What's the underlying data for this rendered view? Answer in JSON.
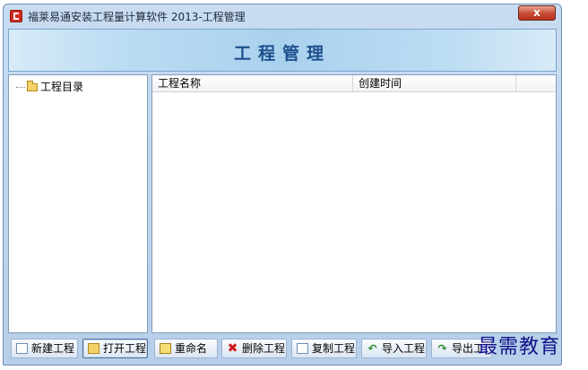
{
  "window": {
    "title": "福莱易通安装工程量计算软件 2013-工程管理",
    "close_label": "x"
  },
  "banner": {
    "title": "工程管理"
  },
  "tree": {
    "root_label": "工程目录",
    "root_icon": "folder-icon"
  },
  "list": {
    "columns": [
      "工程名称",
      "创建时间",
      ""
    ],
    "rows": []
  },
  "toolbar": {
    "buttons": [
      {
        "label": "新建工程",
        "icon": "new-file-icon"
      },
      {
        "label": "打开工程",
        "icon": "folder-open-icon"
      },
      {
        "label": "重命名",
        "icon": "rename-icon"
      },
      {
        "label": "删除工程",
        "icon": "delete-icon"
      },
      {
        "label": "复制工程",
        "icon": "copy-icon"
      },
      {
        "label": "导入工程",
        "icon": "import-icon"
      },
      {
        "label": "导出工",
        "icon": "export-icon"
      }
    ]
  },
  "watermark": {
    "text": "最需教育"
  },
  "colors": {
    "banner_text": "#1d4f8c",
    "close_button": "#c74a32",
    "watermark": "#10128a"
  }
}
